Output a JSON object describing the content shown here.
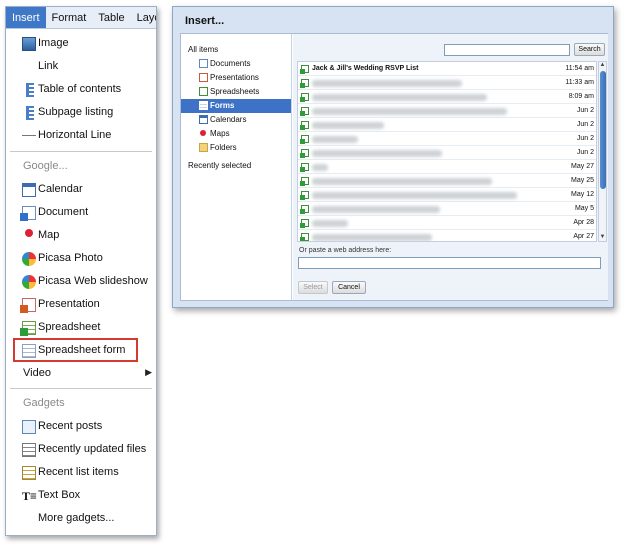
{
  "menubar": {
    "items": [
      "Insert",
      "Format",
      "Table",
      "Layo"
    ]
  },
  "insert_menu": {
    "items": [
      {
        "label": "Image",
        "icon": "image-icon"
      },
      {
        "label": "Link",
        "icon": ""
      },
      {
        "label": "Table of contents",
        "icon": "toc-icon"
      },
      {
        "label": "Subpage listing",
        "icon": "subpage-icon"
      },
      {
        "label": "Horizontal Line",
        "icon": "horizontal-line-icon"
      }
    ],
    "google_heading": "Google...",
    "google_items": [
      {
        "label": "Calendar",
        "icon": "calendar-icon"
      },
      {
        "label": "Document",
        "icon": "document-icon"
      },
      {
        "label": "Map",
        "icon": "map-pin-icon"
      },
      {
        "label": "Picasa Photo",
        "icon": "picasa-icon"
      },
      {
        "label": "Picasa Web slideshow",
        "icon": "picasa-icon"
      },
      {
        "label": "Presentation",
        "icon": "presentation-icon"
      },
      {
        "label": "Spreadsheet",
        "icon": "spreadsheet-icon"
      },
      {
        "label": "Spreadsheet form",
        "icon": "form-icon"
      }
    ],
    "video_label": "Video",
    "gadgets_heading": "Gadgets",
    "gadget_items": [
      {
        "label": "Recent posts",
        "icon": "recent-posts-icon"
      },
      {
        "label": "Recently updated files",
        "icon": "files-icon"
      },
      {
        "label": "Recent list items",
        "icon": "list-items-icon"
      },
      {
        "label": "Text Box",
        "icon": "text-box-icon"
      },
      {
        "label": "More gadgets...",
        "icon": ""
      }
    ],
    "highlight_color": "#d33a32"
  },
  "dialog": {
    "title": "Insert...",
    "tree": {
      "all_items": "All items",
      "children": [
        {
          "label": "Documents",
          "icon": "document-icon"
        },
        {
          "label": "Presentations",
          "icon": "presentation-icon"
        },
        {
          "label": "Spreadsheets",
          "icon": "spreadsheet-icon"
        },
        {
          "label": "Forms",
          "icon": "form-icon"
        },
        {
          "label": "Calendars",
          "icon": "calendar-icon"
        },
        {
          "label": "Maps",
          "icon": "map-pin-icon"
        },
        {
          "label": "Folders",
          "icon": "folder-icon"
        }
      ],
      "selected": "Forms",
      "recently_selected": "Recently selected"
    },
    "search": {
      "value": "",
      "button_label": "Search"
    },
    "files": [
      {
        "name": "Jack & Jill's Wedding RSVP List",
        "date": "11:54 am"
      },
      {
        "name": "",
        "date": "11:33 am"
      },
      {
        "name": "",
        "date": "8:09 am"
      },
      {
        "name": "",
        "date": "Jun 2"
      },
      {
        "name": "",
        "date": "Jun 2"
      },
      {
        "name": "",
        "date": "Jun 2"
      },
      {
        "name": "",
        "date": "Jun 2"
      },
      {
        "name": "",
        "date": "May 27"
      },
      {
        "name": "",
        "date": "May 25"
      },
      {
        "name": "",
        "date": "May 12"
      },
      {
        "name": "",
        "date": "May 5"
      },
      {
        "name": "",
        "date": "Apr 28"
      },
      {
        "name": "",
        "date": "Apr 27"
      }
    ],
    "paste_label": "Or paste a web address here:",
    "paste_value": "",
    "select_label": "Select",
    "cancel_label": "Cancel",
    "accent_color": "#3d72c6"
  }
}
